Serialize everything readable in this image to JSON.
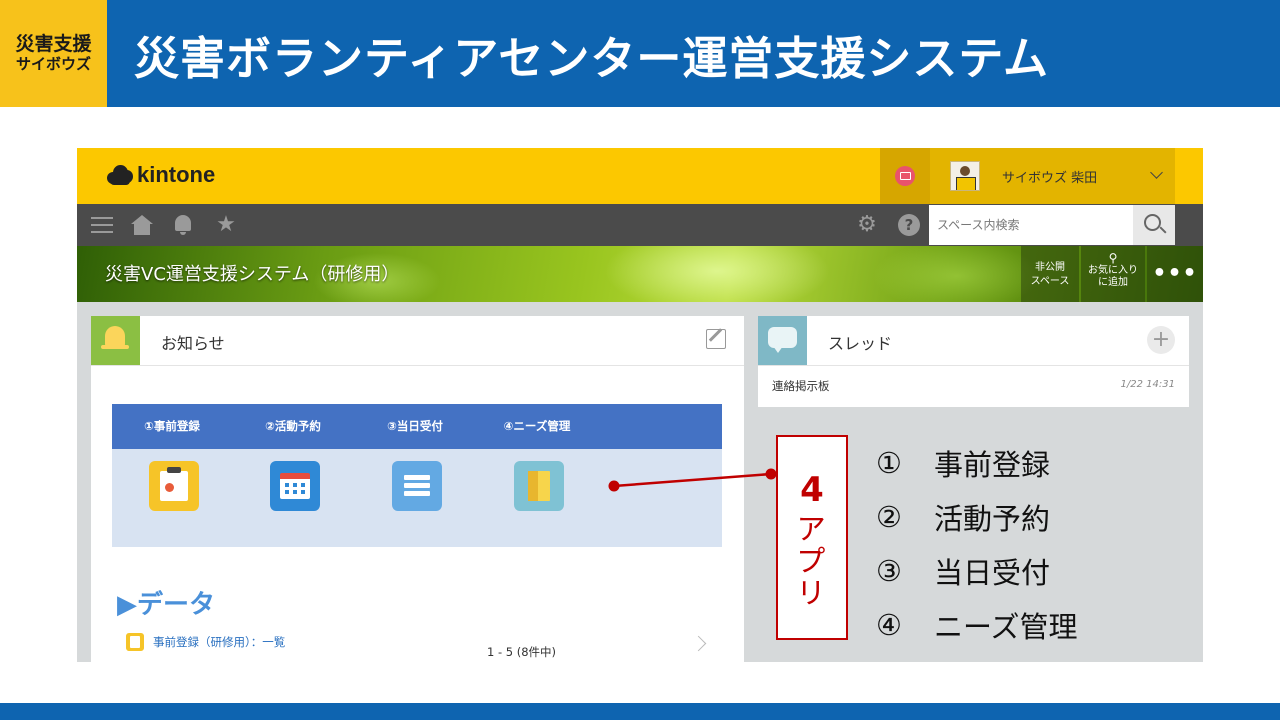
{
  "slide": {
    "logo_line1": "災害支援",
    "logo_line2": "サイボウズ",
    "title": "災害ボランティアセンター運営支援システム"
  },
  "kintone": {
    "logo_text": "kintone",
    "user_name": "サイボウズ 柴田",
    "search_placeholder": "スペース内検索",
    "space_title": "災害VC運営支援システム（研修用）",
    "banner_buttons": {
      "private_space_line1": "非公開",
      "private_space_line2": "スペース",
      "favorite_line1": "お気に入り",
      "favorite_line2": "に追加",
      "more": "•••"
    },
    "notice": {
      "title": "お知らせ",
      "apps": [
        "①事前登録",
        "②活動予約",
        "③当日受付",
        "④ニーズ管理"
      ],
      "data_title": "▶データ",
      "data_link": "事前登録（研修用）：一覧",
      "pager": "1 - 5  (8件中)"
    },
    "thread": {
      "title": "スレッド",
      "item_title": "連絡掲示板",
      "item_time": "1/22 14:31"
    }
  },
  "annotation": {
    "number": "4",
    "label": "アプリ",
    "items": [
      {
        "num": "①",
        "text": "事前登録"
      },
      {
        "num": "②",
        "text": "活動予約"
      },
      {
        "num": "③",
        "text": "当日受付"
      },
      {
        "num": "④",
        "text": "ニーズ管理"
      }
    ],
    "accent_color": "#c00000"
  },
  "colors": {
    "header_blue": "#0e64b0",
    "logo_yellow": "#f7c21b",
    "kintone_yellow": "#fcc800",
    "nav_gray": "#4b4b4b",
    "app_header_blue": "#4472c4"
  }
}
